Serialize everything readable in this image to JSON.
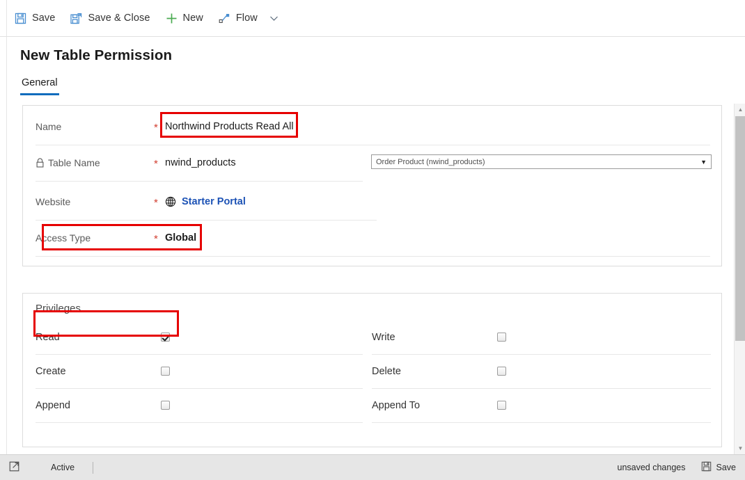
{
  "commandbar": {
    "buttons": [
      {
        "label": "Save",
        "icon": "save-floppy-icon"
      },
      {
        "label": "Save & Close",
        "icon": "save-and-close-icon"
      },
      {
        "label": "New",
        "icon": "plus-icon"
      },
      {
        "label": "Flow",
        "icon": "flow-icon"
      }
    ],
    "overflow_icon": "chevron-down-icon"
  },
  "page": {
    "title": "New Table Permission",
    "tabs": [
      {
        "label": "General",
        "active": true
      }
    ]
  },
  "general": {
    "rows": [
      {
        "label": "Name",
        "required": "*",
        "value": "Northwind Products Read All",
        "locked": false,
        "highlighted": true,
        "bold": false
      },
      {
        "label": "Table Name",
        "required": "*",
        "value": "nwind_products",
        "locked": true,
        "highlighted": false,
        "bold": false
      },
      {
        "label": "Website",
        "required": "*",
        "value": "Starter Portal",
        "locked": false,
        "highlighted": false,
        "link": true,
        "icon": "globe-icon"
      },
      {
        "label": "Access Type",
        "required": "*",
        "value": "Global",
        "locked": false,
        "highlighted": true,
        "bold": true
      }
    ],
    "table_select": {
      "value": "Order Product (nwind_products)",
      "caret": "▼"
    }
  },
  "privileges": {
    "section_title": "Privileges",
    "left": [
      {
        "label": "Read",
        "checked": true,
        "highlighted": true
      },
      {
        "label": "Create",
        "checked": false,
        "highlighted": false
      },
      {
        "label": "Append",
        "checked": false,
        "highlighted": false
      }
    ],
    "right": [
      {
        "label": "Write",
        "checked": false,
        "highlighted": false
      },
      {
        "label": "Delete",
        "checked": false,
        "highlighted": false
      },
      {
        "label": "Append To",
        "checked": false,
        "highlighted": false
      }
    ]
  },
  "statusbar": {
    "expand_icon": "popout-icon",
    "state": "Active",
    "unsaved": "unsaved changes",
    "save_label": "Save",
    "save_icon": "save-floppy-icon"
  },
  "colors": {
    "accent": "#0f6cbd",
    "link": "#1c52b5",
    "required": "#d23f31",
    "highlight": "#e60000",
    "new_green": "#4bab52",
    "save_blue": "#4a8fd1",
    "statusbar_bg": "#e6e6e6"
  },
  "scrollbar": {
    "up_arrow": "▲",
    "down_arrow": "▼"
  }
}
